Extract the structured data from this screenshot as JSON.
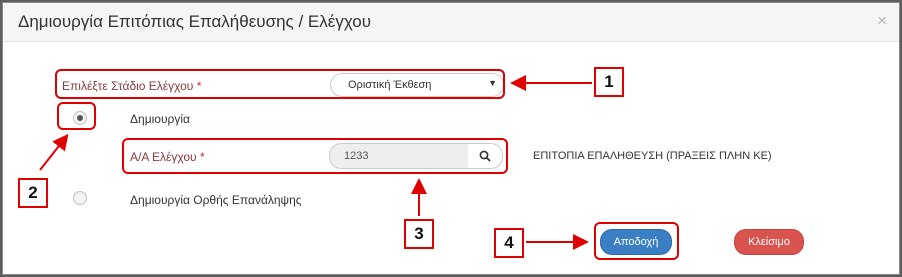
{
  "dialog": {
    "title": "Δημιουργία Επιτόπιας Επαλήθευσης / Ελέγχου",
    "close_symbol": "×"
  },
  "stage": {
    "label": "Επιλέξτε Στάδιο Ελέγχου",
    "required_mark": "*",
    "selected_value": "Οριστική Έκθεση"
  },
  "radios": {
    "create_label": "Δημιουργία",
    "create_selected": true,
    "repeat_label": "Δημιουργία Ορθής Επανάληψης",
    "repeat_selected": false
  },
  "audit_no": {
    "label": "Α/Α Ελέγχου",
    "required_mark": "*",
    "value": "1233",
    "search_icon": "search-icon"
  },
  "info_text": "ΕΠΙΤΟΠΙΑ ΕΠΑΛΗΘΕΥΣΗ (ΠΡΑΞΕΙΣ ΠΛΗΝ ΚΕ)",
  "buttons": {
    "accept_label": "Αποδοχή",
    "close_label": "Κλείσιμο"
  },
  "annotations": {
    "callout_1": "1",
    "callout_2": "2",
    "callout_3": "3",
    "callout_4": "4",
    "highlight_color": "#e00000"
  },
  "colors": {
    "primary": "#3a7fc4",
    "danger": "#d9534f",
    "required": "#c9302c"
  }
}
